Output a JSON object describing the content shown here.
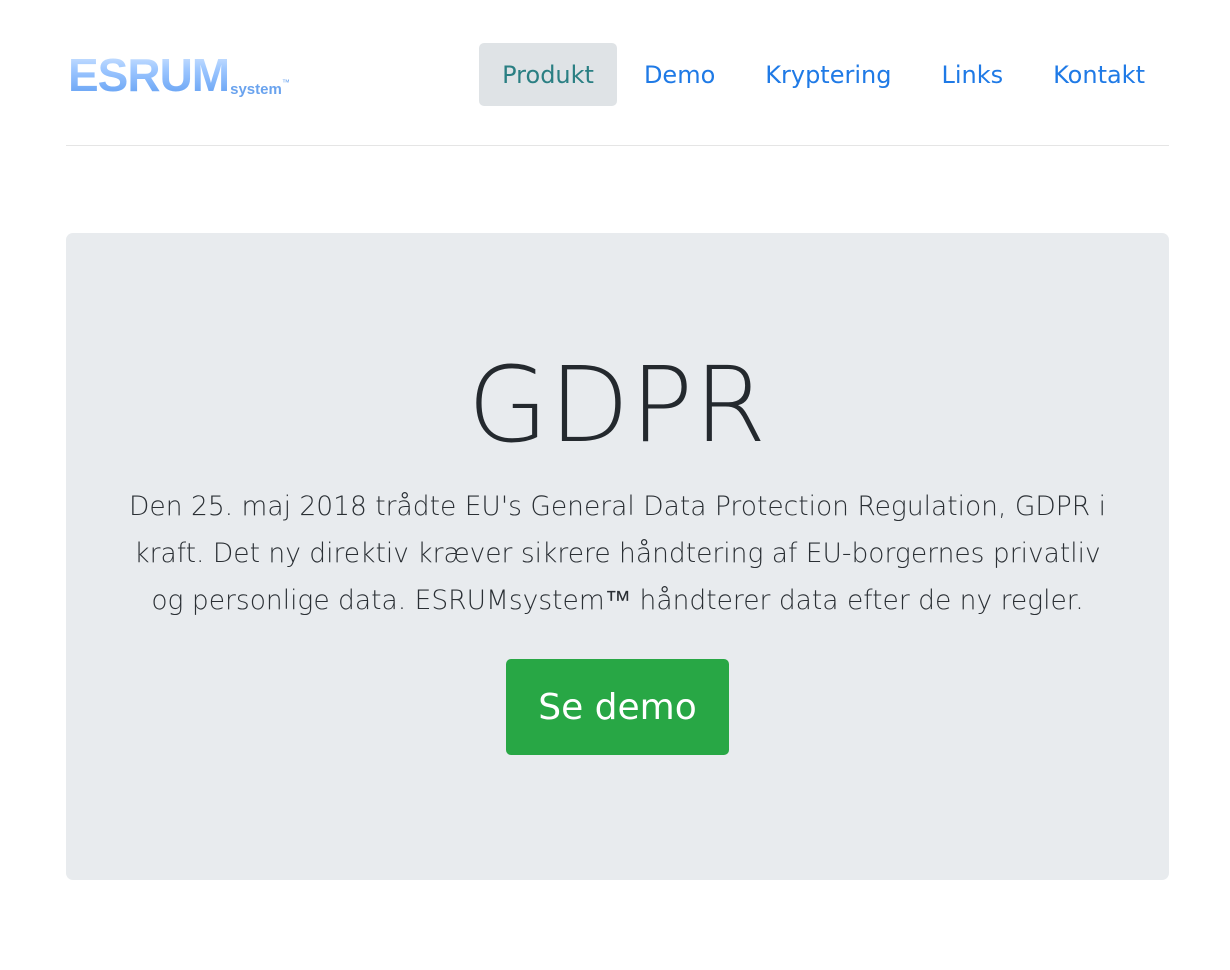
{
  "brand": {
    "main": "ESRUM",
    "sub": "system",
    "tm": "™"
  },
  "nav": {
    "items": [
      {
        "label": "Produkt",
        "active": true
      },
      {
        "label": "Demo",
        "active": false
      },
      {
        "label": "Kryptering",
        "active": false
      },
      {
        "label": "Links",
        "active": false
      },
      {
        "label": "Kontakt",
        "active": false
      }
    ]
  },
  "hero": {
    "title": "GDPR",
    "text": "Den 25. maj 2018 trådte EU's General Data Protection Regulation, GDPR i kraft. Det ny direktiv kræver sikrere håndtering af EU-borgernes privatliv og personlige data. ESRUMsystem™ håndterer data efter de ny regler.",
    "button_label": "Se demo"
  },
  "colors": {
    "nav_link": "#1f7ae6",
    "nav_active_bg": "#dfe3e6",
    "jumbotron_bg": "#e8ebee",
    "button_bg": "#28a745"
  }
}
